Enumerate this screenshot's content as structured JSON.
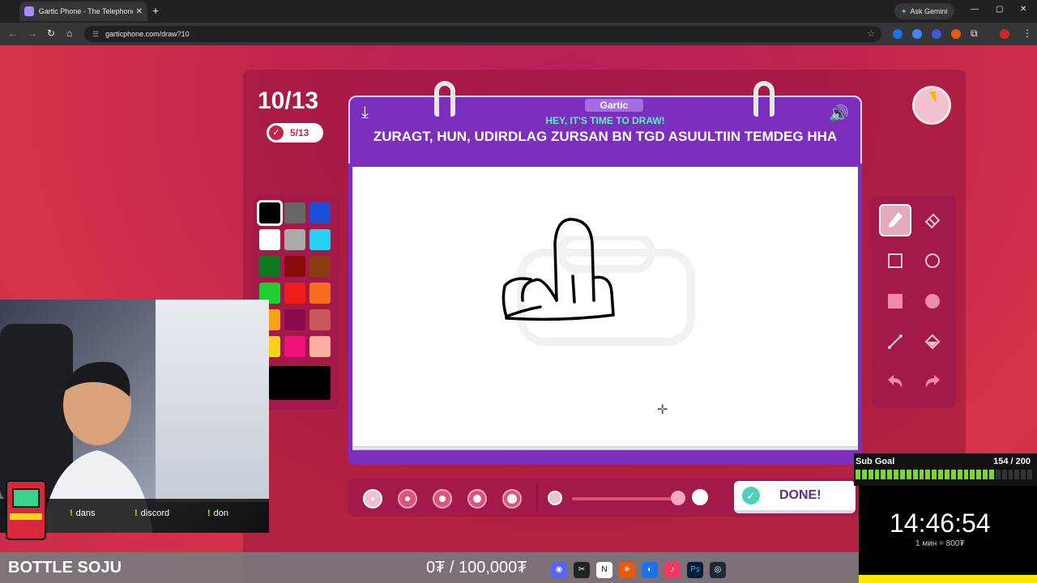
{
  "browser": {
    "tab_title": "Gartic Phone - The Telephone G",
    "tab_close": "✕",
    "new_tab": "+",
    "gemini_label": "Ask Gemini",
    "url": "garticphone.com/draw?10",
    "minimize": "—",
    "maximize": "▢",
    "close": "✕"
  },
  "game": {
    "round": "10/13",
    "score": "5/13",
    "logo": "Gartic",
    "subtitle": "HEY, IT'S TIME TO DRAW!",
    "prompt": "ZURAGT, HUN, UDIRDLAG ZURSAN BN TGD ASUULTIIN TEMDEG HHA",
    "done_label": "DONE!",
    "timer_remaining_fraction": 0.92,
    "palette": [
      "#000000",
      "#666666",
      "#1c4fd8",
      "#ffffff",
      "#aaaaaa",
      "#29d0f5",
      "#0d7a1f",
      "#8a0b0b",
      "#8a3d12",
      "#1ecf30",
      "#ef1a1a",
      "#f76d1f",
      "#f7a21a",
      "#8a0b4a",
      "#c9565a",
      "#f7d21a",
      "#f0107a",
      "#f9b0a0"
    ],
    "selected_color": "#000000",
    "accent": "#7c2ebd"
  },
  "stream": {
    "commands": [
      "dans",
      "discord",
      "don"
    ],
    "channel_name": "BOTTLE SOJU",
    "donation_goal": "0₮ / 100,000₮",
    "sub_goal_label": "Sub Goal",
    "sub_goal_value": "154 / 200",
    "clock": "14:46:54",
    "rate": "1 мин = 800₮"
  }
}
